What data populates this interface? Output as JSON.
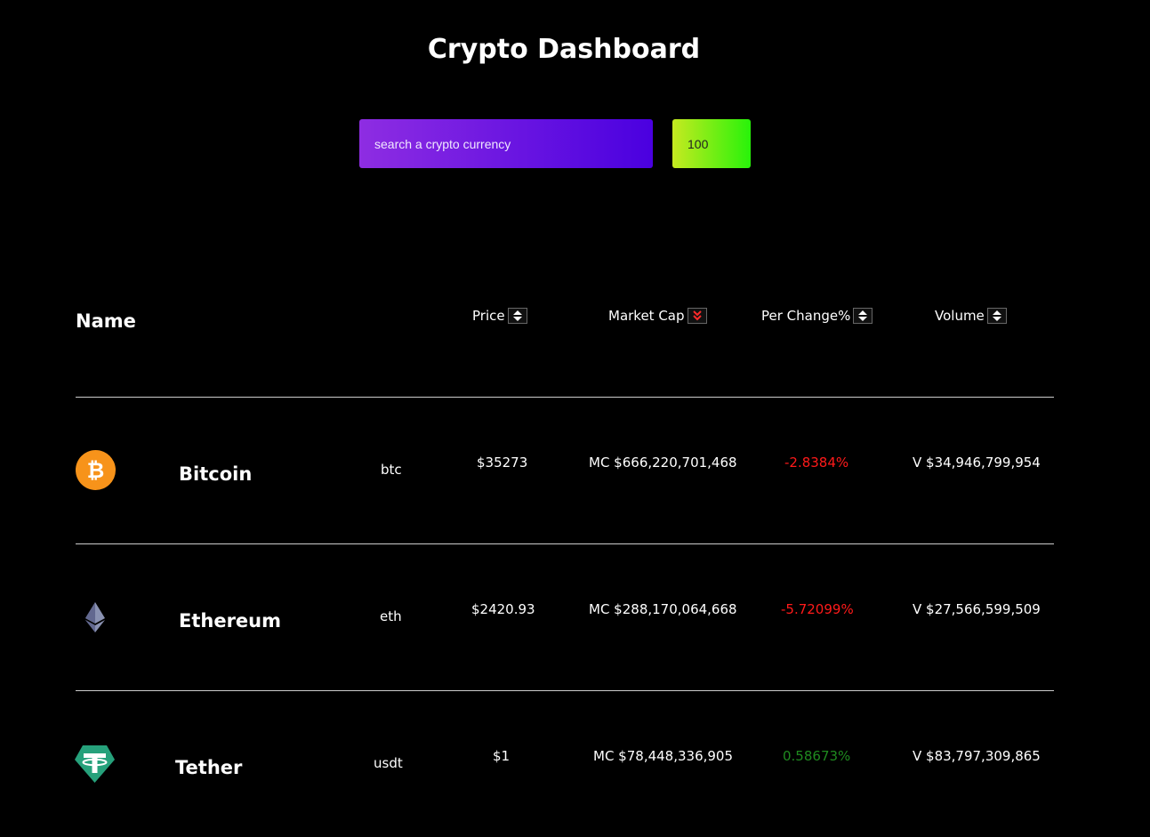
{
  "title": "Crypto Dashboard",
  "search": {
    "placeholder": "search a crypto currency",
    "count_value": "100"
  },
  "table": {
    "headers": {
      "name": "Name",
      "price": "Price",
      "market_cap": "Market Cap",
      "per_change": "Per Change%",
      "volume": "Volume"
    },
    "active_sort": "market_cap",
    "rows": [
      {
        "icon": "bitcoin-icon",
        "name": "Bitcoin",
        "symbol": "btc",
        "price": "$35273",
        "market_cap": "MC $666,220,701,468",
        "change": "-2.8384%",
        "change_color": "#ff1a1a",
        "volume": "V $34,946,799,954"
      },
      {
        "icon": "ethereum-icon",
        "name": "Ethereum",
        "symbol": "eth",
        "price": "$2420.93",
        "market_cap": "MC $288,170,064,668",
        "change": "-5.72099%",
        "change_color": "#ff1a1a",
        "volume": "V $27,566,599,509"
      },
      {
        "icon": "tether-icon",
        "name": "Tether",
        "symbol": "usdt",
        "price": "$1",
        "market_cap": "MC $78,448,336,905",
        "change": "0.58673%",
        "change_color": "#1f8a1f",
        "volume": "V $83,797,309,865"
      }
    ]
  }
}
